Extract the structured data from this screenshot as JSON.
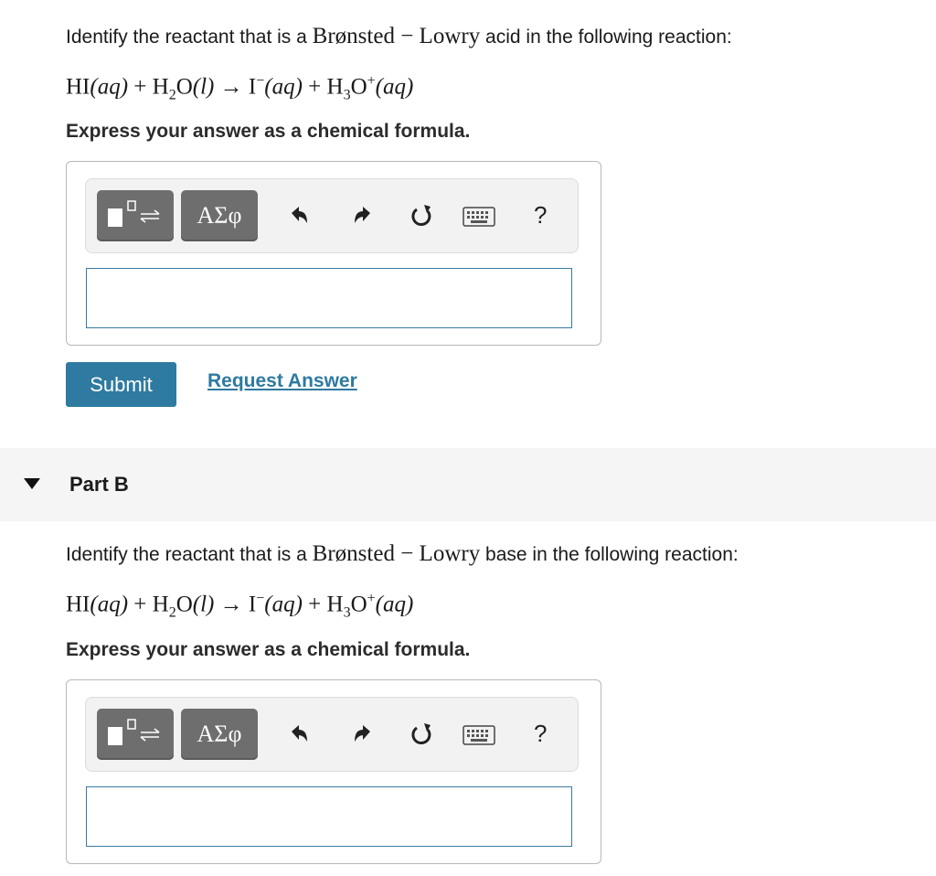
{
  "partA": {
    "question_prefix": "Identify the reactant that is a",
    "question_term": "Brønsted − Lowry",
    "question_suffix": "acid in the following reaction:",
    "equation": {
      "r1": "HI",
      "r1_state": "(aq)",
      "plus1": "+",
      "r2_a": "H",
      "r2_sub": "2",
      "r2_b": "O",
      "r2_state": "(l)",
      "arrow": "→",
      "p1": "I",
      "p1_sup": "−",
      "p1_state": "(aq)",
      "plus2": "+",
      "p2_a": "H",
      "p2_sub": "3",
      "p2_b": "O",
      "p2_sup": "+",
      "p2_state": "(aq)"
    },
    "instruction": "Express your answer as a chemical formula.",
    "toolbar": {
      "greek_label": "ΑΣφ",
      "help_label": "?"
    },
    "answer_value": "",
    "submit_label": "Submit",
    "request_answer_label": "Request Answer"
  },
  "partB": {
    "title": "Part B",
    "question_prefix": "Identify the reactant that is a",
    "question_term": "Brønsted − Lowry",
    "question_suffix": "base in the following reaction:",
    "instruction": "Express your answer as a chemical formula.",
    "toolbar": {
      "greek_label": "ΑΣφ",
      "help_label": "?"
    },
    "answer_value": ""
  },
  "icons": {
    "templates": "templates-icon",
    "undo": "undo-icon",
    "redo": "redo-icon",
    "reset": "reset-icon",
    "keyboard": "keyboard-icon",
    "help": "help-icon"
  },
  "colors": {
    "accent": "#2e7aa0",
    "toolbar_button": "#6e6e6e",
    "input_border": "#3a7ba6"
  }
}
